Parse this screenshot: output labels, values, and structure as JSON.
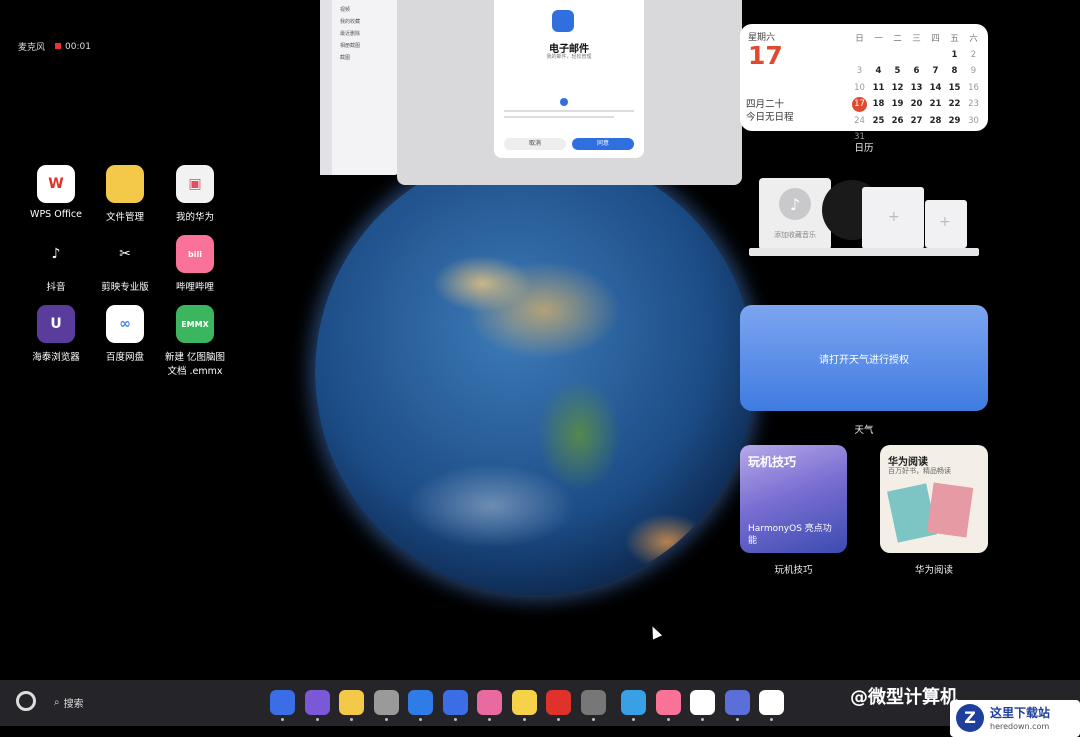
{
  "status": {
    "mic": "麦克风",
    "timer": "00:01"
  },
  "desktop": [
    {
      "label": "WPS Office",
      "color": "#fff",
      "fg": "#e0322a",
      "glyph": "W"
    },
    {
      "label": "文件管理",
      "color": "#f4c94a",
      "fg": "#fff",
      "glyph": ""
    },
    {
      "label": "我的华为",
      "color": "#f2f2f2",
      "fg": "#e05060",
      "glyph": "▣"
    },
    {
      "label": "抖音",
      "color": "#000",
      "fg": "#fff",
      "glyph": "♪"
    },
    {
      "label": "剪映专业版",
      "color": "#000",
      "fg": "#fff",
      "glyph": "✂"
    },
    {
      "label": "哔哩哔哩",
      "color": "#fb7299",
      "fg": "#fff",
      "glyph": "bili"
    },
    {
      "label": "海泰浏览器",
      "color": "#5a3c9c",
      "fg": "#fff",
      "glyph": "U"
    },
    {
      "label": "百度网盘",
      "color": "#fff",
      "fg": "#3b82f6",
      "glyph": "∞"
    },
    {
      "label": "新建 亿图脑图\n文档 .emmx",
      "color": "#3bb55e",
      "fg": "#fff",
      "glyph": "EMMX"
    }
  ],
  "sidebar_window": {
    "items": [
      "视频",
      "我的收藏",
      "最近删除",
      "相册截图",
      "截图"
    ]
  },
  "mail": {
    "title": "电子邮件",
    "subtitle": "我的邮件，轻松管理",
    "cancel": "取消",
    "ok": "同意"
  },
  "calendar": {
    "weekday": "星期六",
    "day": "17",
    "lunar": "四月二十",
    "schedule": "今日无日程",
    "headers": [
      "日",
      "一",
      "二",
      "三",
      "四",
      "五",
      "六"
    ],
    "rows": [
      [
        "",
        "",
        "",
        "",
        "",
        "1",
        "2"
      ],
      [
        "3",
        "4",
        "5",
        "6",
        "7",
        "8",
        "9"
      ],
      [
        "10",
        "11",
        "12",
        "13",
        "14",
        "15",
        "16"
      ],
      [
        "17",
        "18",
        "19",
        "20",
        "21",
        "22",
        "23"
      ],
      [
        "24",
        "25",
        "26",
        "27",
        "28",
        "29",
        "30"
      ],
      [
        "31",
        "",
        "",
        "",
        "",
        "",
        ""
      ]
    ],
    "label": "日历"
  },
  "music": {
    "add": "添加收藏音乐"
  },
  "weather": {
    "text": "请打开天气进行授权",
    "label": "天气"
  },
  "tips": {
    "title": "玩机技巧",
    "caption": "HarmonyOS 亮点功能",
    "label": "玩机技巧"
  },
  "reading": {
    "title": "华为阅读",
    "subtitle": "百万好书，精品畅读",
    "label": "华为阅读"
  },
  "dock": {
    "search": "搜索",
    "watermark": "@微型计算机",
    "site": "这里下载站",
    "domain": "heredown.com",
    "apps": [
      {
        "name": "launcher",
        "color": "#3b6ee6"
      },
      {
        "name": "folder",
        "color": "#7a58d8"
      },
      {
        "name": "files",
        "color": "#f4c94a"
      },
      {
        "name": "trash",
        "color": "#9a9a9a"
      },
      {
        "name": "browser",
        "color": "#2f7be8"
      },
      {
        "name": "mail",
        "color": "#3b6ee6"
      },
      {
        "name": "gallery",
        "color": "#e86aa0"
      },
      {
        "name": "notes",
        "color": "#f6d24a"
      },
      {
        "name": "app-gallery",
        "color": "#e0322a"
      },
      {
        "name": "settings",
        "color": "#777"
      },
      {
        "name": "finder",
        "color": "#3aa0e6"
      },
      {
        "name": "bilibili",
        "color": "#fb7299"
      },
      {
        "name": "wps",
        "color": "#ffffff"
      },
      {
        "name": "music",
        "color": "#5a6fd8"
      },
      {
        "name": "calendar",
        "color": "#ffffff"
      }
    ]
  }
}
